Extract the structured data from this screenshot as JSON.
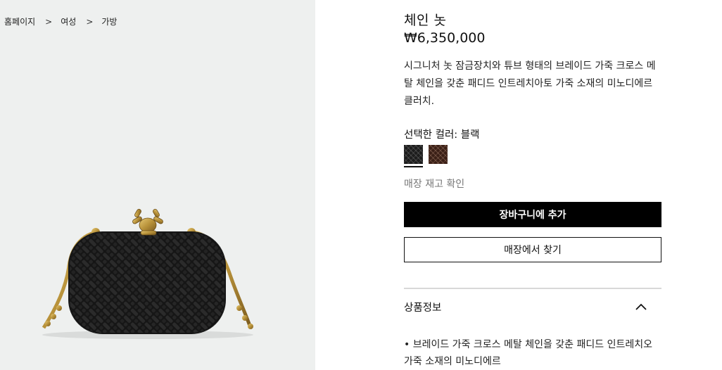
{
  "breadcrumb": {
    "items": [
      "홈페이지",
      "여성",
      "가방"
    ],
    "separator": ">"
  },
  "product": {
    "title": "체인 놋",
    "price": "₩6,350,000",
    "description": "시그니처 놋 잠금장치와 튜브 형태의 브레이드 가죽 크로스 메탈 체인을 갖춘 패디드 인트레치아토 가죽 소재의 미노디에르 클러치.",
    "selected_color_label": "선택한 컬러: 블랙",
    "swatches": [
      {
        "name": "블랙",
        "color": "#1c1c1c",
        "selected": true
      },
      {
        "name": "브라운",
        "color": "#3a1f16",
        "selected": false
      }
    ],
    "store_stock_link": "매장 재고 확인",
    "add_to_cart": "장바구니에 추가",
    "find_in_store": "매장에서 찾기",
    "accordion": {
      "title": "상품정보",
      "expanded": true,
      "bullet": "• 브레이드 가죽 크로스 메탈 체인을 갖춘 패디드 인트레치오 가죽 소재의 미노디에르"
    }
  },
  "colors": {
    "gallery_bg": "#eef0ef",
    "primary_button": "#000000",
    "muted_text": "#777777",
    "gold_hardware": "#b8923a"
  }
}
